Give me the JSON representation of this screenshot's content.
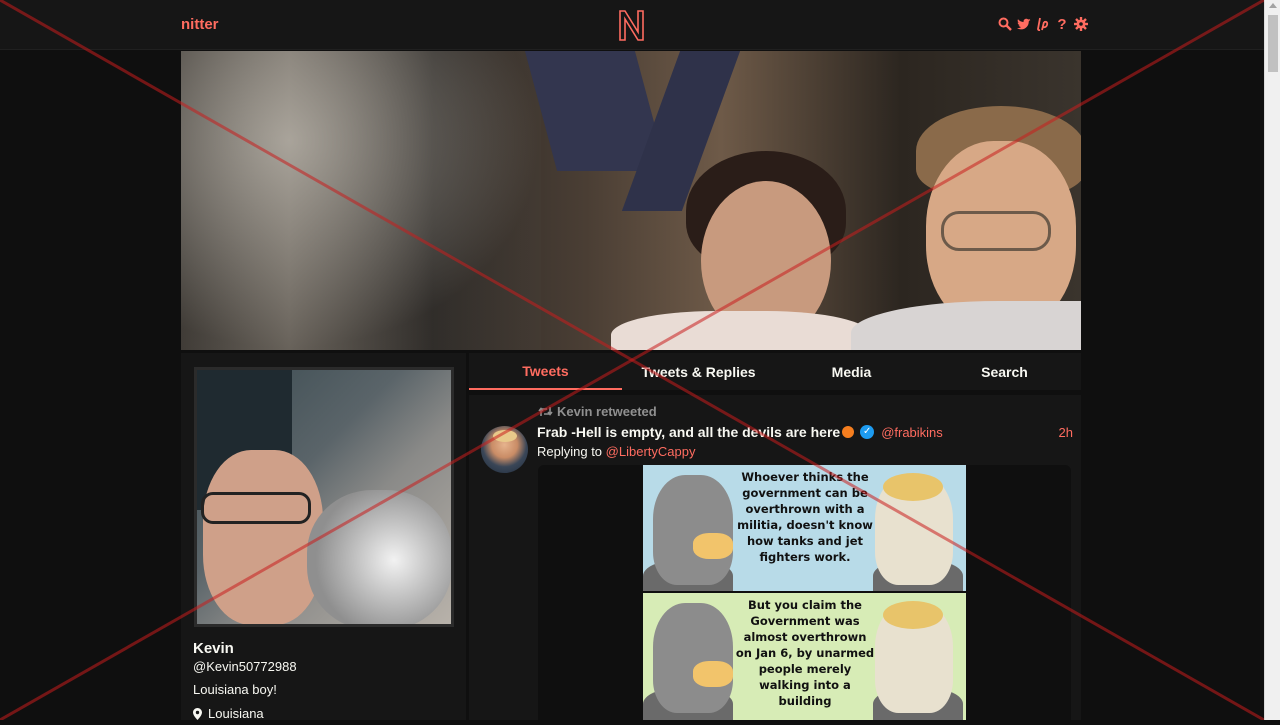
{
  "navbar": {
    "brand": "nitter",
    "logo_letter": "N",
    "icons": [
      "search-icon",
      "twitter-bird-icon",
      "liberapay-icon",
      "help-icon",
      "settings-icon"
    ],
    "accent_color": "#ff6c60"
  },
  "profile": {
    "fullname": "Kevin",
    "username": "@Kevin50772988",
    "bio": "Louisiana boy!",
    "location": "Louisiana"
  },
  "tabs": [
    {
      "label": "Tweets",
      "active": true
    },
    {
      "label": "Tweets & Replies",
      "active": false
    },
    {
      "label": "Media",
      "active": false
    },
    {
      "label": "Search",
      "active": false
    }
  ],
  "tweet": {
    "retweet_header": "Kevin retweeted",
    "fullname": "Frab -Hell is empty, and all the devils are here",
    "username": "@frabikins",
    "date": "2h",
    "replying_prefix": "Replying to",
    "replying_to": "@LibertyCappy",
    "comic": {
      "panel1_text": "Whoever thinks the government can be overthrown with a militia, doesn't know how tanks and jet fighters work.",
      "panel2_text": "But you claim the Government was almost overthrown on Jan 6, by unarmed people merely walking into a building"
    }
  }
}
